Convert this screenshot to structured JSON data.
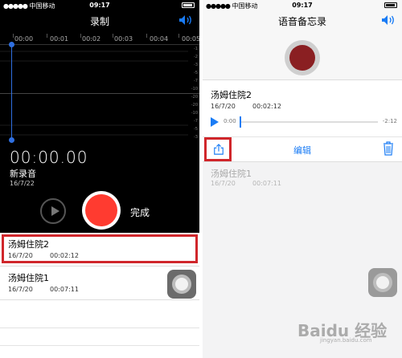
{
  "left": {
    "status": {
      "carrier": "中国移动",
      "time": "09:17"
    },
    "title": "录制",
    "timeline": [
      "00:00",
      "00:01",
      "00:02",
      "00:03",
      "00:04",
      "00:05"
    ],
    "db_scale": [
      "-1",
      "-2",
      "-3",
      "-5",
      "-7",
      "-10",
      "-20",
      "-20",
      "-10",
      "-7",
      "-5",
      "-3",
      "-2",
      "-1"
    ],
    "elapsed": "00:00.00",
    "new_name": "新录音",
    "new_date": "16/7/22",
    "done_label": "完成",
    "recordings": [
      {
        "name": "汤姆住院2",
        "date": "16/7/20",
        "duration": "00:02:12"
      },
      {
        "name": "汤姆住院1",
        "date": "16/7/20",
        "duration": "00:07:11"
      }
    ]
  },
  "right": {
    "status": {
      "carrier": "中国移动",
      "time": "09:17"
    },
    "title": "语音备忘录",
    "selected": {
      "name": "汤姆住院2",
      "date": "16/7/20",
      "duration": "00:02:12",
      "current": "0:00",
      "remaining": "-2:12"
    },
    "edit_label": "编辑",
    "other": {
      "name": "汤姆住院1",
      "date": "16/7/20",
      "duration": "00:07:11"
    }
  },
  "watermark": {
    "text": "Baidu 经验",
    "url": "jingyan.baidu.com"
  },
  "colors": {
    "record_red": "#ff3b30",
    "highlight_red": "#d0262b",
    "ios_blue": "#1a7cf5"
  }
}
